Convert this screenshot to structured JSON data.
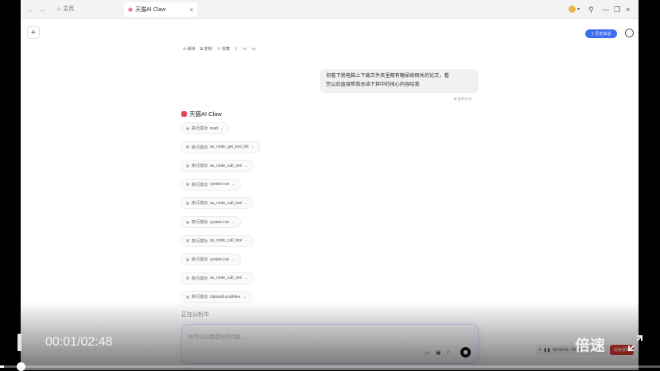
{
  "browser": {
    "home_tab": "主页",
    "active_tab": "天猫AI Claw"
  },
  "header": {
    "pill_label": "历史会话"
  },
  "toolbar": [
    "朗读",
    "复制",
    "收藏"
  ],
  "user_message": {
    "line1": "你看下我电脑上下载文件夹里都有糖尿病相关的论文，看",
    "line2": "完以后直接帮我总结下其中的核心内容给我",
    "copy_label": "复制文本"
  },
  "assistant": {
    "name": "天猫AI Claw"
  },
  "steps": [
    {
      "status": "执行成功",
      "tool": "read"
    },
    {
      "status": "执行成功",
      "tool": "as_node_get_tool_list"
    },
    {
      "status": "执行成功",
      "tool": "as_node_call_tool"
    },
    {
      "status": "执行成功",
      "tool": "system.run"
    },
    {
      "status": "执行成功",
      "tool": "as_node_call_tool"
    },
    {
      "status": "执行成功",
      "tool": "system.run"
    },
    {
      "status": "执行成功",
      "tool": "as_node_call_tool"
    },
    {
      "status": "执行成功",
      "tool": "system.run"
    },
    {
      "status": "执行成功",
      "tool": "as_node_call_tool"
    },
    {
      "status": "执行成功",
      "tool": "UploadLocalFiles"
    }
  ],
  "analyzing": "正在分析中",
  "input": {
    "placeholder": "你可以向我提任何问题..."
  },
  "recorder": {
    "time": "00:00:01 / 00:00",
    "stop_label": "结束录制"
  },
  "video": {
    "time": "00:01/02:48",
    "speed_label": "倍速",
    "progress": 0.006
  }
}
